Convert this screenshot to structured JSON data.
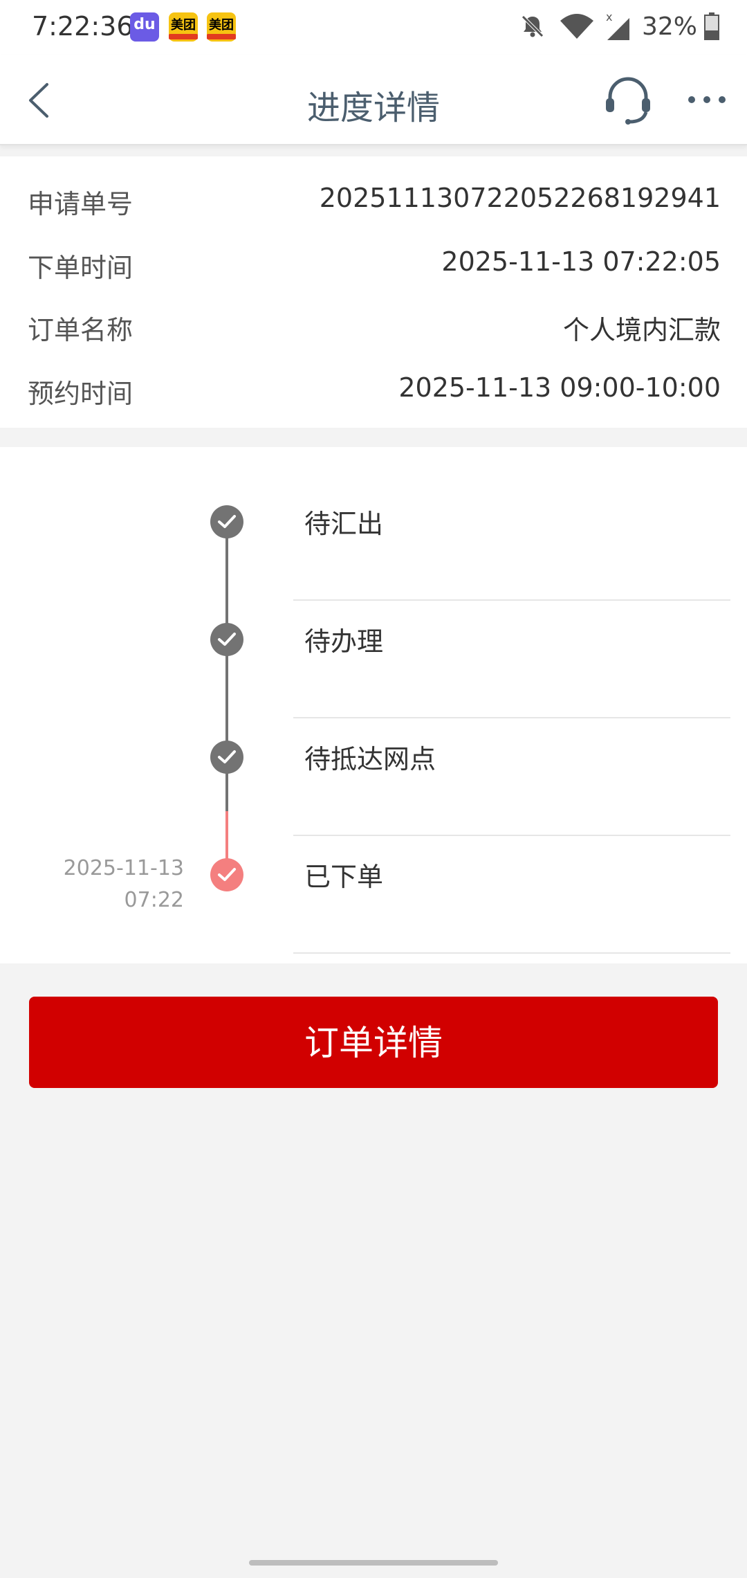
{
  "status_bar": {
    "time": "7:22:36",
    "notifications": [
      {
        "icon": "baidu-app-icon",
        "glyph": "du"
      },
      {
        "icon": "meituan-app-icon",
        "glyph": "美团"
      },
      {
        "icon": "meituan-app-icon",
        "glyph": "美团"
      }
    ],
    "battery": "32%"
  },
  "header": {
    "title": "进度详情"
  },
  "info": {
    "rows": [
      {
        "label": "申请单号",
        "value": "202511130722052268192941"
      },
      {
        "label": "下单时间",
        "value": "2025-11-13 07:22:05"
      },
      {
        "label": "订单名称",
        "value": "个人境内汇款"
      },
      {
        "label": "预约时间",
        "value": "2025-11-13 09:00-10:00"
      }
    ]
  },
  "timeline": {
    "steps": [
      {
        "label": "待汇出",
        "status": "pending"
      },
      {
        "label": "待办理",
        "status": "pending"
      },
      {
        "label": "待抵达网点",
        "status": "pending"
      },
      {
        "label": "已下单",
        "status": "current",
        "date": "2025-11-13",
        "time": "07:22"
      }
    ]
  },
  "actions": {
    "order_detail_label": "订单详情"
  },
  "colors": {
    "primary_red": "#d10000",
    "current_step": "#f47f7f",
    "done_step": "#737373",
    "title": "#4b5e6e"
  }
}
